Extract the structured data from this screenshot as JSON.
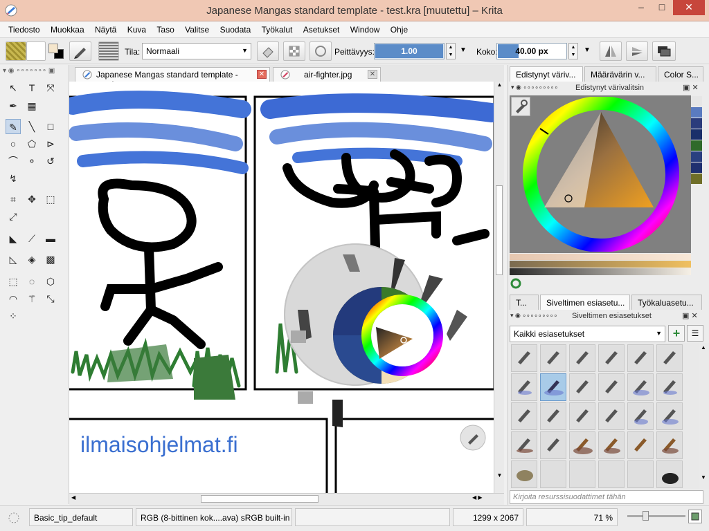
{
  "window": {
    "title": "Japanese Mangas standard template - test.kra [muutettu] – Krita",
    "controls": {
      "minimize": "–",
      "maximize": "□",
      "close": "✕"
    }
  },
  "menu": [
    "Tiedosto",
    "Muokkaa",
    "Näytä",
    "Kuva",
    "Taso",
    "Valitse",
    "Suodata",
    "Työkalut",
    "Asetukset",
    "Window",
    "Ohje"
  ],
  "toolbar": {
    "mode_label": "Tila:",
    "mode_value": "Normaali",
    "opacity_label": "Peittävyys:",
    "opacity_value": "1.00",
    "size_label": "Koko:",
    "size_value": "40.00 px"
  },
  "tabs": [
    {
      "label": "Japanese Mangas standard template - test.kra",
      "active": true
    },
    {
      "label": "air-fighter.jpg",
      "active": false
    }
  ],
  "canvas": {
    "watermark": "ilmaisohjelmat.fi"
  },
  "right_dock": {
    "top_tabs": [
      "Edistynyt väriv...",
      "Määrävärin v...",
      "Color S..."
    ],
    "color_panel_title": "Edistynyt värivalitsin",
    "bottom_tabs": [
      "T...",
      "Siveltimen esiasetu...",
      "Työkaluasetu..."
    ],
    "presets_panel_title": "Siveltimen esiasetukset",
    "preset_filter": "Kaikki esiasetukset",
    "search_placeholder": "Kirjoita resurssisuodattimet tähän"
  },
  "status": {
    "brush": "Basic_tip_default",
    "colorspace": "RGB (8-bittinen kok....ava)  sRGB built-in",
    "dimensions": "1299 x 2067",
    "zoom": "71 %"
  },
  "colors": {
    "title_bar": "#f0c8b4",
    "close_button": "#c7463b",
    "accent": "#5b8cc8",
    "watermark": "#3a6fd0"
  }
}
